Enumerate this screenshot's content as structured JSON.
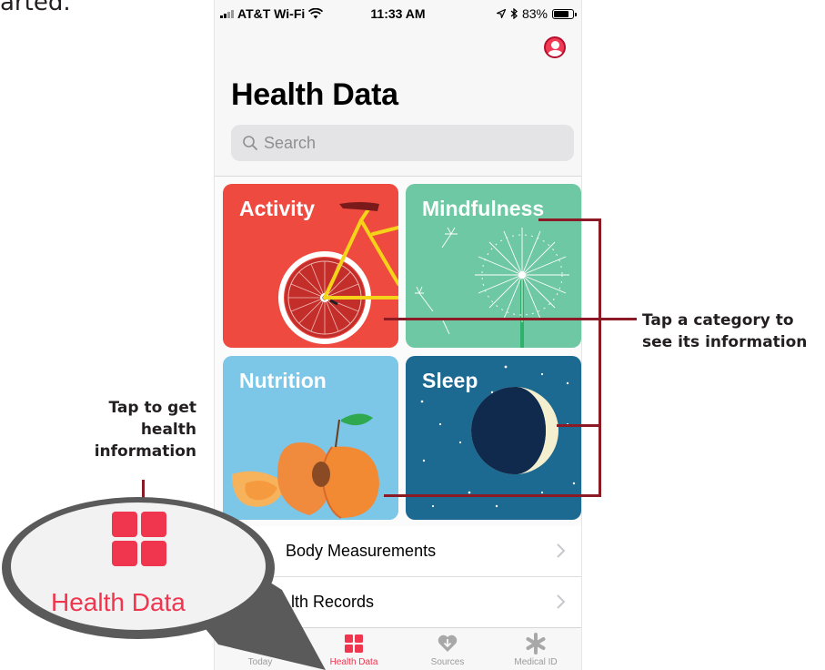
{
  "page_caption": "arted.",
  "status_bar": {
    "carrier": "AT&T Wi-Fi",
    "time": "11:33 AM",
    "battery": "83%"
  },
  "header": {
    "title": "Health Data"
  },
  "search": {
    "placeholder": "Search"
  },
  "categories": [
    {
      "label": "Activity",
      "color": "#ef4a3f"
    },
    {
      "label": "Mindfulness",
      "color": "#6ec8a3"
    },
    {
      "label": "Nutrition",
      "color": "#7cc6e8"
    },
    {
      "label": "Sleep",
      "color": "#1c6a91"
    }
  ],
  "list_rows": [
    {
      "label": "Body Measurements"
    },
    {
      "label": "lth Records"
    }
  ],
  "tab_bar": {
    "tabs": [
      {
        "label": "Today",
        "icon": "calendar-icon",
        "active": false
      },
      {
        "label": "Health Data",
        "icon": "grid-icon",
        "active": true
      },
      {
        "label": "Sources",
        "icon": "sources-heart-icon",
        "active": false
      },
      {
        "label": "Medical ID",
        "icon": "asterisk-icon",
        "active": false
      }
    ]
  },
  "annotations": {
    "category_callout_line1": "Tap a category to",
    "category_callout_line2": "see its information",
    "tab_callout_line1": "Tap to get",
    "tab_callout_line2": "health",
    "tab_callout_line3": "information"
  },
  "magnifier": {
    "label": "Health Data"
  },
  "colors": {
    "accent": "#f0354f",
    "callout_line": "#8b1a24"
  }
}
